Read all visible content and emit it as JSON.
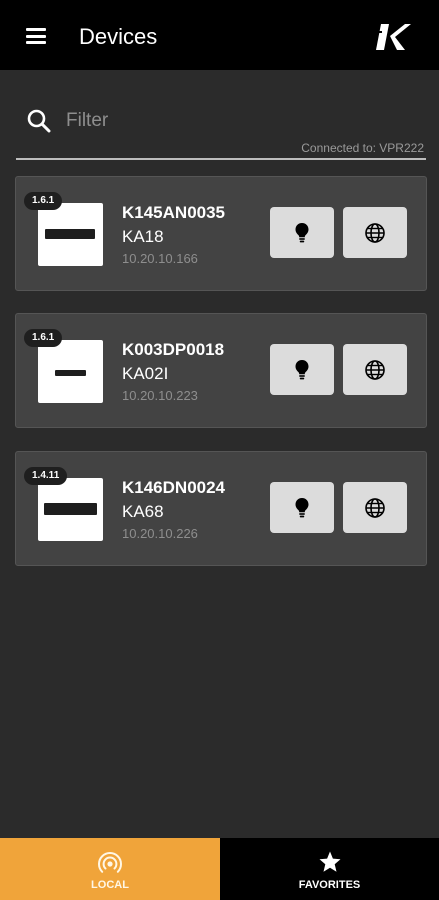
{
  "header": {
    "title": "Devices",
    "menu_icon": "hamburger-menu-icon",
    "logo_icon": "brand-k-logo"
  },
  "filter": {
    "placeholder": "Filter",
    "value": "",
    "connected_label": "Connected to: VPR222"
  },
  "devices": [
    {
      "badge": "1.6.1",
      "serial": "K145AN0035",
      "model": "KA18",
      "ip": "10.20.10.166"
    },
    {
      "badge": "1.6.1",
      "serial": "K003DP0018",
      "model": "KA02I",
      "ip": "10.20.10.223"
    },
    {
      "badge": "1.4.11",
      "serial": "K146DN0024",
      "model": "KA68",
      "ip": "10.20.10.226"
    }
  ],
  "tabs": [
    {
      "label": "LOCAL",
      "icon": "wireless-signal-icon",
      "active": true
    },
    {
      "label": "FAVORITES",
      "icon": "star-icon",
      "active": false
    }
  ],
  "colors": {
    "accent": "#f0a43a",
    "card": "#434343",
    "background": "#2b2b2b",
    "bar": "#000000"
  }
}
